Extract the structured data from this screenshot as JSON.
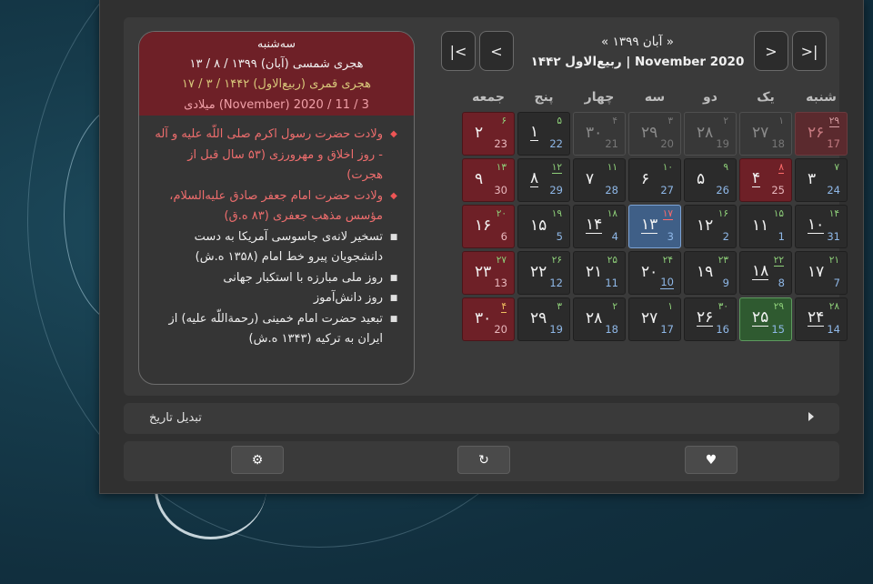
{
  "events_card": {
    "header": {
      "weekday": "سه‌شنبه",
      "solar": "۱۳ / ۸ / ۱۳۹۹ (آبان) هجری شمسی",
      "lunar": "۱۷ / ۳ / ۱۴۴۲ (ربیع‌الاول) هجری قمری",
      "gregorian": "میلادی (November) 2020 / 11 / 3"
    },
    "events": [
      {
        "type": "holiday",
        "text": "ولادت حضرت رسول اکرم صلی اللّه علیه و آله - روز اخلاق و مهرورزی (۵۳ سال قبل از هجرت)"
      },
      {
        "type": "holiday",
        "text": "ولادت حضرت امام جعفر صادق علیه‌السلام، مؤسس مذهب جعفری (۸۳ ه.ق)"
      },
      {
        "type": "normal",
        "text": "تسخیر لانه‌ی جاسوسی آمریکا به دست دانشجویان پیرو خط امام (۱۳۵۸ ه.ش)"
      },
      {
        "type": "normal",
        "text": "روز ملی مبارزه با استکبار جهانی"
      },
      {
        "type": "normal",
        "text": "روز دانش‌آموز"
      },
      {
        "type": "normal",
        "text": "تبعید حضرت امام خمینی (رحمة‌اللّه علیه) از ایران به ترکیه (۱۳۴۳ ه.ش)"
      }
    ]
  },
  "calendar": {
    "title_line1": "« آبان ۱۳۹۹ »",
    "title_line2": "ربیع‌الاول ۱۴۴۲ | November 2020",
    "weekdays": [
      "شنبه",
      "یک",
      "دو",
      "سه",
      "چهار",
      "پنج",
      "جمعه"
    ],
    "weeks": [
      [
        {
          "p": "۲۶",
          "h": "۲۹",
          "g": "17",
          "other": true,
          "holiday": true,
          "hu": true
        },
        {
          "p": "۲۷",
          "h": "۱",
          "g": "18",
          "other": true
        },
        {
          "p": "۲۸",
          "h": "۲",
          "g": "19",
          "other": true
        },
        {
          "p": "۲۹",
          "h": "۳",
          "g": "20",
          "other": true
        },
        {
          "p": "۳۰",
          "h": "۴",
          "g": "21",
          "other": true
        },
        {
          "p": "۱",
          "h": "۵",
          "g": "22",
          "pu": true
        },
        {
          "p": "۲",
          "h": "۶",
          "g": "23",
          "holiday": true
        }
      ],
      [
        {
          "p": "۳",
          "h": "۷",
          "g": "24"
        },
        {
          "p": "۴",
          "h": "۸",
          "g": "25",
          "holiday": true,
          "pu": true,
          "hred": true,
          "hu": true
        },
        {
          "p": "۵",
          "h": "۹",
          "g": "26"
        },
        {
          "p": "۶",
          "h": "۱۰",
          "g": "27"
        },
        {
          "p": "۷",
          "h": "۱۱",
          "g": "28"
        },
        {
          "p": "۸",
          "h": "۱۲",
          "g": "29",
          "pu": true,
          "hu": true
        },
        {
          "p": "۹",
          "h": "۱۳",
          "g": "30",
          "holiday": true
        }
      ],
      [
        {
          "p": "۱۰",
          "h": "۱۴",
          "g": "31",
          "pu": true
        },
        {
          "p": "۱۱",
          "h": "۱۵",
          "g": "1"
        },
        {
          "p": "۱۲",
          "h": "۱۶",
          "g": "2"
        },
        {
          "p": "۱۳",
          "h": "۱۷",
          "g": "3",
          "today": true,
          "pu": true,
          "hred": true,
          "hu": true
        },
        {
          "p": "۱۴",
          "h": "۱۸",
          "g": "4",
          "pu": true
        },
        {
          "p": "۱۵",
          "h": "۱۹",
          "g": "5"
        },
        {
          "p": "۱۶",
          "h": "۲۰",
          "g": "6",
          "holiday": true
        }
      ],
      [
        {
          "p": "۱۷",
          "h": "۲۱",
          "g": "7"
        },
        {
          "p": "۱۸",
          "h": "۲۲",
          "g": "8",
          "pu": true,
          "hu": true
        },
        {
          "p": "۱۹",
          "h": "۲۳",
          "g": "9"
        },
        {
          "p": "۲۰",
          "h": "۲۴",
          "g": "10",
          "gu": true
        },
        {
          "p": "۲۱",
          "h": "۲۵",
          "g": "11"
        },
        {
          "p": "۲۲",
          "h": "۲۶",
          "g": "12"
        },
        {
          "p": "۲۳",
          "h": "۲۷",
          "g": "13",
          "holiday": true
        }
      ],
      [
        {
          "p": "۲۴",
          "h": "۲۸",
          "g": "14",
          "pu": true
        },
        {
          "p": "۲۵",
          "h": "۲۹",
          "g": "15",
          "selected": true,
          "pu": true
        },
        {
          "p": "۲۶",
          "h": "۳۰",
          "g": "16",
          "pu": true
        },
        {
          "p": "۲۷",
          "h": "۱",
          "g": "17"
        },
        {
          "p": "۲۸",
          "h": "۲",
          "g": "18"
        },
        {
          "p": "۲۹",
          "h": "۳",
          "g": "19"
        },
        {
          "p": "۳۰",
          "h": "۴",
          "g": "20",
          "holiday": true,
          "horange": true,
          "hu": true
        }
      ]
    ]
  },
  "nav": {
    "first_icon": "skip-first-icon",
    "prev_icon": "chevron-left-icon",
    "next_icon": "chevron-right-icon",
    "last_icon": "skip-last-icon"
  },
  "convert": {
    "label": "تبدیل تاریخ"
  },
  "actions": {
    "settings_icon": "gear-icon",
    "refresh_icon": "refresh-icon",
    "favorite_icon": "heart-icon"
  },
  "colors": {
    "holiday": "#6e2027",
    "today": "#3f5f87",
    "selected": "#2f5a30",
    "panel": "#303030"
  }
}
